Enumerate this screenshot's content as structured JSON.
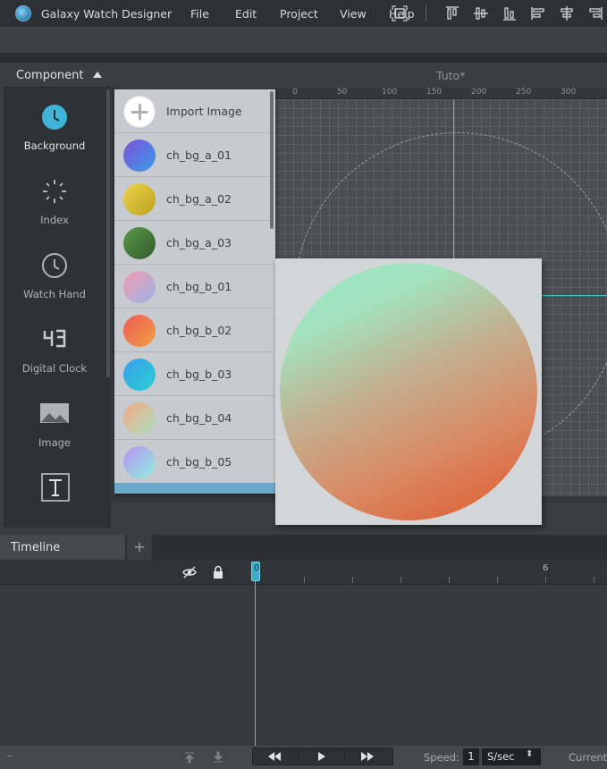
{
  "app": {
    "title": "Galaxy Watch Designer"
  },
  "menu": {
    "items": [
      "File",
      "Edit",
      "Project",
      "View",
      "Help"
    ]
  },
  "toolbar": {
    "icons": [
      "fit-screen-icon",
      "align-top-icon",
      "align-vertical-center-icon",
      "align-bottom-icon",
      "align-left-icon",
      "align-horizontal-center-icon",
      "align-right-icon"
    ]
  },
  "component_panel": {
    "title": "Component",
    "items": [
      {
        "label": "Background",
        "icon": "background-clock-icon"
      },
      {
        "label": "Index",
        "icon": "index-icon"
      },
      {
        "label": "Watch Hand",
        "icon": "watch-hand-icon"
      },
      {
        "label": "Digital Clock",
        "icon": "digital-clock-icon"
      },
      {
        "label": "Image",
        "icon": "image-icon"
      },
      {
        "label": "",
        "icon": "text-icon"
      }
    ]
  },
  "document": {
    "tab_title": "Tuto*"
  },
  "ruler": {
    "labels": [
      "0",
      "50",
      "100",
      "150",
      "200",
      "250",
      "300"
    ]
  },
  "image_list": {
    "import_label": "Import Image",
    "items": [
      {
        "name": "ch_bg_a_01",
        "colors": [
          "#7b4fd8",
          "#3aa0e8"
        ]
      },
      {
        "name": "ch_bg_a_02",
        "colors": [
          "#f0d54a",
          "#b8a020"
        ]
      },
      {
        "name": "ch_bg_a_03",
        "colors": [
          "#5b9a4a",
          "#2f5a2a"
        ]
      },
      {
        "name": "ch_bg_b_01",
        "colors": [
          "#f39ab0",
          "#9ab6e8"
        ]
      },
      {
        "name": "ch_bg_b_02",
        "colors": [
          "#f05a5a",
          "#f0a040"
        ]
      },
      {
        "name": "ch_bg_b_03",
        "colors": [
          "#3a9ef0",
          "#2ad0d0"
        ]
      },
      {
        "name": "ch_bg_b_04",
        "colors": [
          "#f5a880",
          "#a8e0c0"
        ]
      },
      {
        "name": "ch_bg_b_05",
        "colors": [
          "#b890f0",
          "#90f0e0"
        ]
      }
    ]
  },
  "timeline": {
    "tab_label": "Timeline",
    "add_label": "+",
    "playhead": "0",
    "tick_label": "6"
  },
  "bottom_bar": {
    "dash": "–",
    "speed_label": "Speed:",
    "speed_value": "1",
    "speed_unit": "S/sec",
    "current_label": "Current:"
  },
  "colors": {
    "accent": "#3fc6d6",
    "selection": "#6aa9cc"
  }
}
